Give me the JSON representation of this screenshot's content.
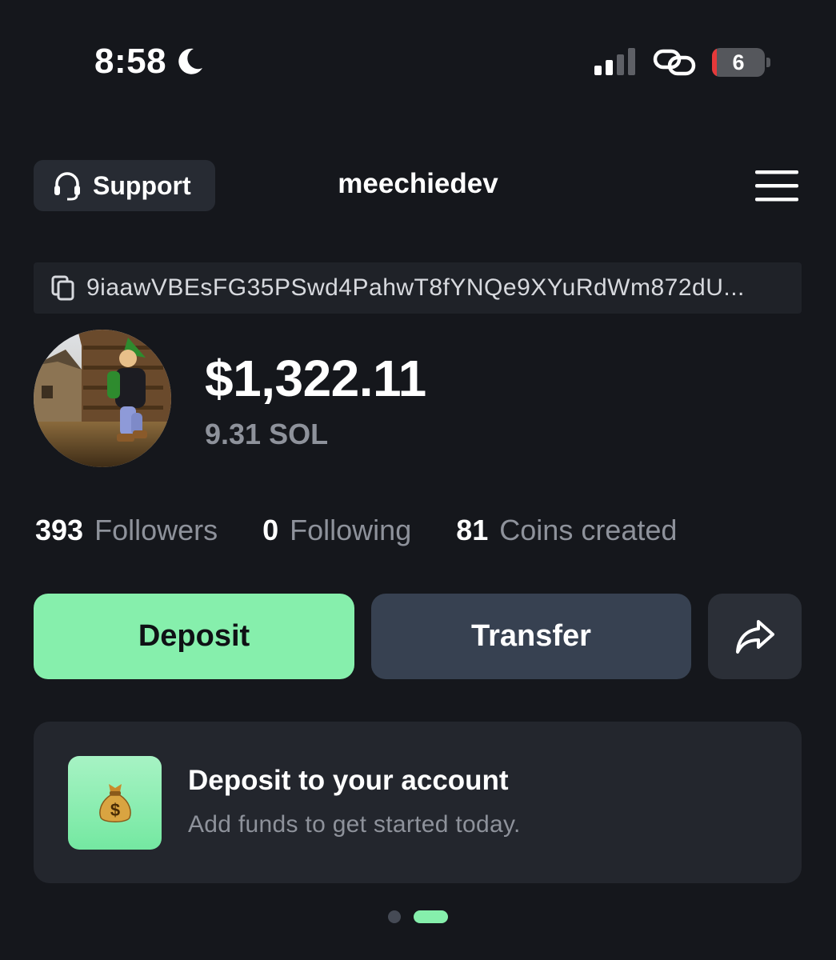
{
  "status_bar": {
    "time": "8:58",
    "battery_level": "6"
  },
  "header": {
    "support_label": "Support",
    "username": "meechiedev"
  },
  "wallet": {
    "address": "9iaawVBEsFG35PSwd4PahwT8fYNQe9XYuRdWm872dU..."
  },
  "profile": {
    "balance_usd": "$1,322.11",
    "balance_sol": "9.31 SOL"
  },
  "stats": [
    {
      "value": "393",
      "label": "Followers"
    },
    {
      "value": "0",
      "label": "Following"
    },
    {
      "value": "81",
      "label": "Coins created"
    }
  ],
  "actions": {
    "deposit_label": "Deposit",
    "transfer_label": "Transfer"
  },
  "promo": {
    "title": "Deposit to your account",
    "subtitle": "Add funds to get started today."
  },
  "pager": {
    "count": 2,
    "active": 2
  },
  "colors": {
    "background": "#15171c",
    "accent_green": "#86efac",
    "transfer_button": "#374151",
    "muted_text": "#8e929b"
  },
  "icons": [
    "moon-icon",
    "signal-icon",
    "link-icon",
    "battery-icon",
    "headset-icon",
    "hamburger-menu-icon",
    "copy-icon",
    "share-arrow-icon",
    "money-bag-icon"
  ]
}
